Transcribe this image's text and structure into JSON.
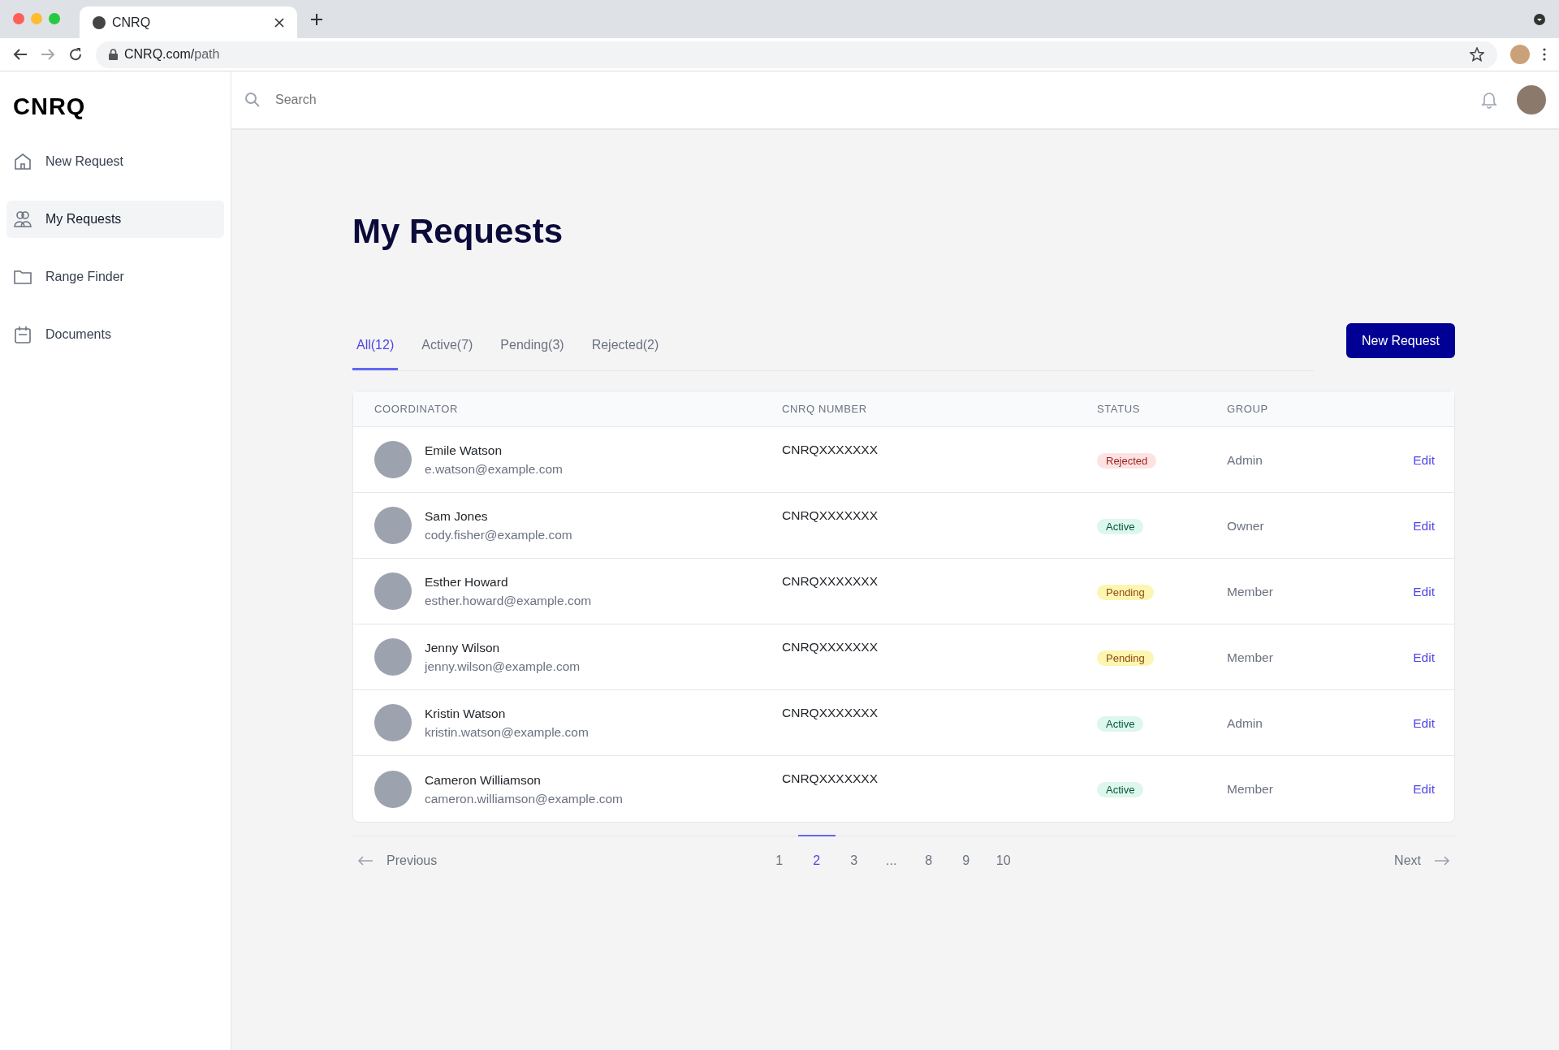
{
  "browser": {
    "tab_title": "CNRQ",
    "url_host": "CNRQ.com/",
    "url_path": "path"
  },
  "sidebar": {
    "logo": "CNRQ",
    "items": [
      {
        "label": "New Request",
        "selected": false
      },
      {
        "label": "My Requests",
        "selected": true
      },
      {
        "label": "Range Finder",
        "selected": false
      },
      {
        "label": "Documents",
        "selected": false
      }
    ]
  },
  "topbar": {
    "search": {
      "placeholder": "Search"
    }
  },
  "page_title": "My Requests",
  "tabs": [
    {
      "label": "All(12)",
      "selected": true
    },
    {
      "label": "Active(7)",
      "selected": false
    },
    {
      "label": "Pending(3)",
      "selected": false
    },
    {
      "label": "Rejected(2)",
      "selected": false
    }
  ],
  "new_request_button": "New Request",
  "table": {
    "columns": [
      "COORDINATOR",
      "CNRQ NUMBER",
      "STATUS",
      "GROUP"
    ],
    "rows": [
      {
        "name": "Emile Watson",
        "email": "e.watson@example.com",
        "number": "CNRQXXXXXXX",
        "status": "Rejected",
        "kind": "rejected",
        "group": "Admin",
        "action": "Edit"
      },
      {
        "name": "Sam Jones",
        "email": "cody.fisher@example.com",
        "number": "CNRQXXXXXXX",
        "status": "Active",
        "kind": "active",
        "group": "Owner",
        "action": "Edit"
      },
      {
        "name": "Esther Howard",
        "email": "esther.howard@example.com",
        "number": "CNRQXXXXXXX",
        "status": "Pending",
        "kind": "pending",
        "group": "Member",
        "action": "Edit"
      },
      {
        "name": "Jenny Wilson",
        "email": "jenny.wilson@example.com",
        "number": "CNRQXXXXXXX",
        "status": "Pending",
        "kind": "pending",
        "group": "Member",
        "action": "Edit"
      },
      {
        "name": "Kristin Watson",
        "email": "kristin.watson@example.com",
        "number": "CNRQXXXXXXX",
        "status": "Active",
        "kind": "active",
        "group": "Admin",
        "action": "Edit"
      },
      {
        "name": "Cameron Williamson",
        "email": "cameron.williamson@example.com",
        "number": "CNRQXXXXXXX",
        "status": "Active",
        "kind": "active",
        "group": "Member",
        "action": "Edit"
      }
    ]
  },
  "pagination": {
    "previous": "Previous",
    "next": "Next",
    "pages": [
      {
        "label": "1",
        "selected": false
      },
      {
        "label": "2",
        "selected": true
      },
      {
        "label": "3",
        "selected": false
      },
      {
        "label": "...",
        "selected": false
      },
      {
        "label": "8",
        "selected": false
      },
      {
        "label": "9",
        "selected": false
      },
      {
        "label": "10",
        "selected": false
      }
    ]
  }
}
